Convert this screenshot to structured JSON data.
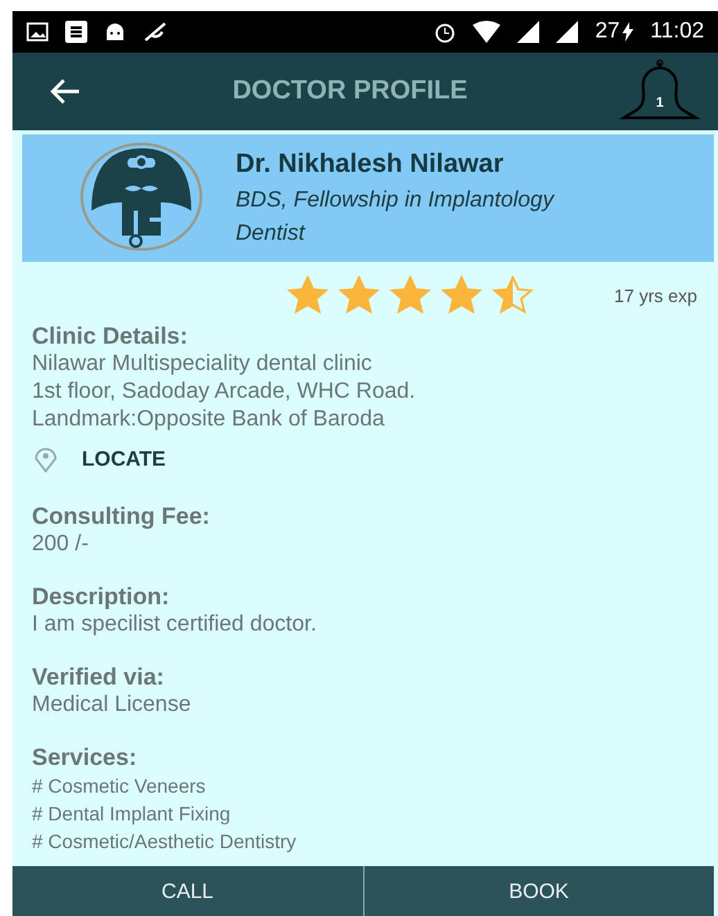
{
  "status_bar": {
    "battery": "27",
    "time": "11:02"
  },
  "app_bar": {
    "title": "DOCTOR PROFILE",
    "notification_count": "1"
  },
  "doctor": {
    "name": "Dr. Nikhalesh Nilawar",
    "qualification": "BDS, Fellowship in Implantology",
    "specialty": "Dentist"
  },
  "rating": {
    "stars": 4.5,
    "experience": "17 yrs exp"
  },
  "clinic": {
    "heading": "Clinic Details:",
    "lines": [
      "Nilawar Multispeciality dental clinic",
      "1st floor, Sadoday Arcade, WHC Road.",
      "Landmark:Opposite Bank of Baroda"
    ],
    "locate": "LOCATE"
  },
  "sections": [
    {
      "heading": "Consulting Fee:",
      "value": "200 /-"
    },
    {
      "heading": "Description:",
      "value": "I am specilist certified doctor."
    },
    {
      "heading": "Verified via:",
      "value": "Medical License"
    }
  ],
  "services": {
    "heading": "Services:",
    "items": [
      "# Cosmetic Veneers",
      "# Dental Implant Fixing",
      "# Cosmetic/Aesthetic Dentistry"
    ]
  },
  "actions": [
    "CALL",
    "BOOK"
  ]
}
